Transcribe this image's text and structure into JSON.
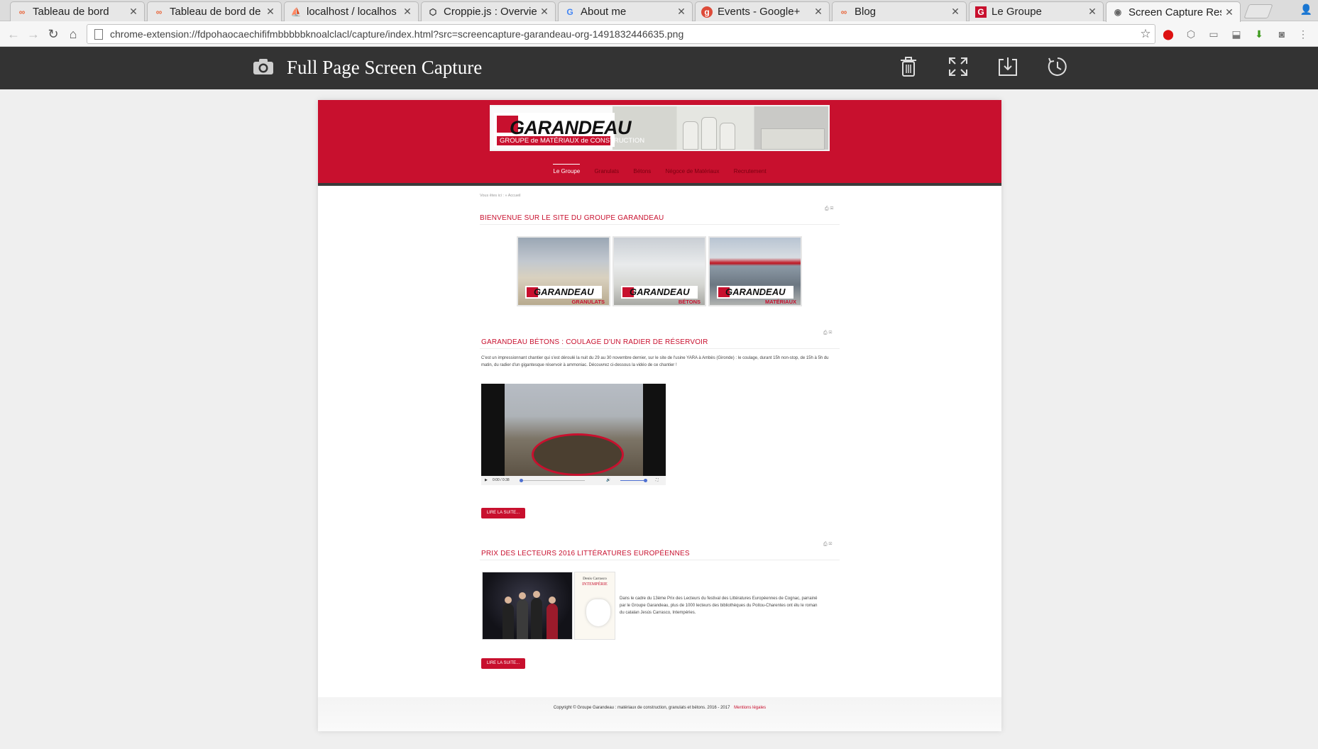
{
  "browser": {
    "tabs": [
      {
        "title": "Tableau de bord",
        "icon": "infinity-icon",
        "active": false
      },
      {
        "title": "Tableau de bord de",
        "icon": "infinity-icon",
        "active": false
      },
      {
        "title": "localhost / localhos",
        "icon": "phpmyadmin-icon",
        "active": false
      },
      {
        "title": "Croppie.js : Overvie",
        "icon": "codepen-icon",
        "active": false
      },
      {
        "title": "About me",
        "icon": "google-icon",
        "active": false
      },
      {
        "title": "Events - Google+",
        "icon": "google-plus-icon",
        "active": false
      },
      {
        "title": "Blog",
        "icon": "infinity-icon",
        "active": false
      },
      {
        "title": "Le Groupe",
        "icon": "garandeau-icon",
        "active": false
      },
      {
        "title": "Screen Capture Res",
        "icon": "camera-icon",
        "active": true
      }
    ],
    "url": "chrome-extension://fdpohaocaechififmbbbbbknoalclacl/capture/index.html?src=screencapture-garandeau-org-1491832446635.png"
  },
  "capture_header": {
    "title": "Full Page Screen Capture",
    "actions": [
      "trash-icon",
      "fullscreen-icon",
      "download-icon",
      "history-icon"
    ]
  },
  "site": {
    "banner": {
      "logo": "GARANDEAU",
      "tagline": "GROUPE de MATÉRIAUX de CONSTRUCTION"
    },
    "nav": [
      "Le Groupe",
      "Granulats",
      "Bétons",
      "Négoce de Matériaux",
      "Recrutement"
    ],
    "breadcrumb": "Vous êtes ici :  »  Accueil",
    "welcome_title": "BIENVENUE SUR LE SITE DU GROUPE GARANDEAU",
    "brands": [
      {
        "name": "GARANDEAU",
        "sub": "GRANULATS"
      },
      {
        "name": "GARANDEAU",
        "sub": "BÉTONS"
      },
      {
        "name": "GARANDEAU",
        "sub": "MATÉRIAUX"
      }
    ],
    "article1": {
      "title": "GARANDEAU BÉTONS : COULAGE D'UN RADIER DE RÉSERVOIR",
      "text": "C'est un impressionnant chantier qui s'est déroulé la nuit du 29 au 30 novembre dernier, sur le site de l'usine YARA à Ambès (Gironde) : le coulage, durant 15h non-stop, de 15h à 5h du matin, du radier d'un gigantesque réservoir à ammoniac. Découvrez ci-dessous la vidéo de ce chantier !",
      "video_time": "0:00 / 0:38",
      "video_progress": 0.0,
      "volume": 1.0,
      "readmore": "LIRE LA SUITE..."
    },
    "article2": {
      "title": "PRIX DES LECTEURS 2016 LITTÉRATURES EUROPÉENNES",
      "book_author": "Denis Carrasco",
      "book_title": "INTEMPÉRIE",
      "text": "Dans le cadre du 13ème Prix des Lecteurs du festival des Littératures Européennes de Cognac, parrainé par le Groupe Garandeau, plus de 1000 lecteurs des bibliothèques du Poitou-Charentes ont élu le roman du catalan Jesús Carrasco, Intempéries.",
      "readmore": "LIRE LA SUITE..."
    },
    "footer": {
      "text": "Copyright © Groupe Garandeau : matériaux de construction, granulats et bétons. 2016 - 2017",
      "legal": "Mentions légales"
    }
  },
  "colors": {
    "brand_red": "#c8102e",
    "header_dark": "#333333"
  }
}
